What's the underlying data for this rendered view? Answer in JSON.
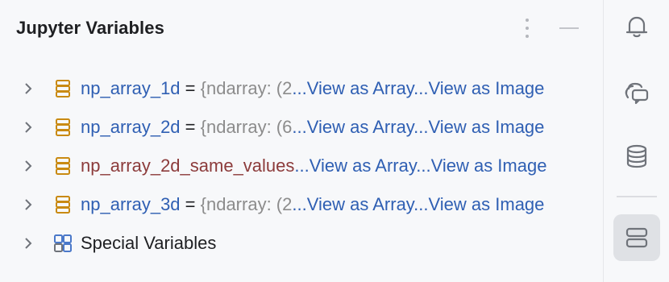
{
  "panel": {
    "title": "Jupyter Variables"
  },
  "variables": [
    {
      "name": "np_array_1d",
      "separator": " = ",
      "value": "{ndarray: (2",
      "ellipsis": "...",
      "link_array": "View as Array",
      "ellipsis2": "...",
      "link_image": "View as Image",
      "changed": false
    },
    {
      "name": "np_array_2d",
      "separator": " = ",
      "value": "{ndarray: (6",
      "ellipsis": "...",
      "link_array": "View as Array",
      "ellipsis2": "...",
      "link_image": "View as Image",
      "changed": false
    },
    {
      "name": "np_array_2d_same_values",
      "separator": "",
      "value": "",
      "ellipsis": "...",
      "link_array": "View as Array",
      "ellipsis2": "...",
      "link_image": "View as Image",
      "changed": true
    },
    {
      "name": "np_array_3d",
      "separator": " = ",
      "value": "{ndarray: (2",
      "ellipsis": "...",
      "link_array": "View as Array",
      "ellipsis2": "...",
      "link_image": "View as Image",
      "changed": false
    }
  ],
  "special": {
    "label": "Special Variables"
  },
  "colors": {
    "accent": "#2f5fb3",
    "changed_name": "#8c3b3b",
    "variable_icon": "#c98a12",
    "special_icon": "#4a78c9",
    "active_tool": "#dfe1e5"
  },
  "toolstrip": {
    "icons": [
      "bell-icon",
      "ai-chat-icon",
      "database-icon",
      "jupyter-variables-icon"
    ],
    "active": "jupyter-variables-icon"
  }
}
